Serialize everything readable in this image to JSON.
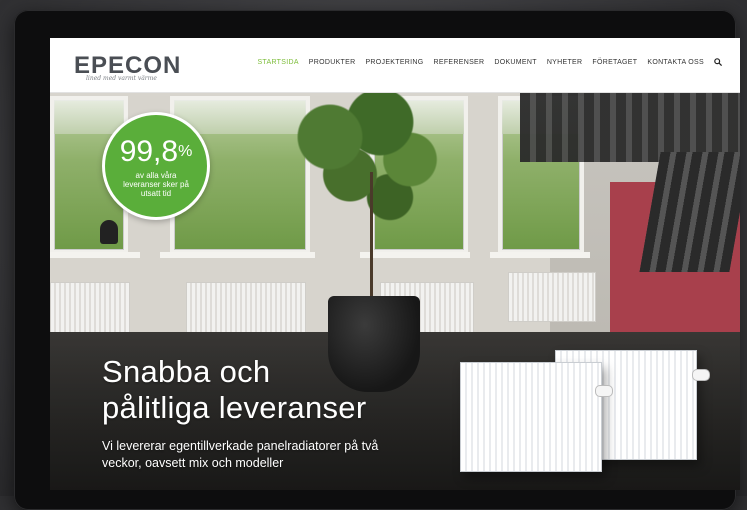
{
  "site": {
    "logo": "EPECON",
    "tagline": "lined med varmt värme"
  },
  "nav": {
    "items": [
      {
        "label": "STARTSIDA",
        "active": true
      },
      {
        "label": "PRODUKTER",
        "active": false
      },
      {
        "label": "PROJEKTERING",
        "active": false
      },
      {
        "label": "REFERENSER",
        "active": false
      },
      {
        "label": "DOKUMENT",
        "active": false
      },
      {
        "label": "NYHETER",
        "active": false
      },
      {
        "label": "FÖRETAGET",
        "active": false
      },
      {
        "label": "KONTAKTA OSS",
        "active": false
      }
    ],
    "search_icon": "search-icon"
  },
  "badge": {
    "value": "99,8",
    "unit": "%",
    "text": "av alla våra leveranser sker på utsatt tid"
  },
  "hero": {
    "headline_line1": "Snabba och",
    "headline_line2": "pålitliga leveranser",
    "subline": "Vi levererar egentillverkade panelradiatorer på två veckor, oavsett mix och modeller"
  },
  "colors": {
    "accent": "#7dbd3a",
    "badge": "#5aae3a",
    "nav_text": "#333333"
  }
}
